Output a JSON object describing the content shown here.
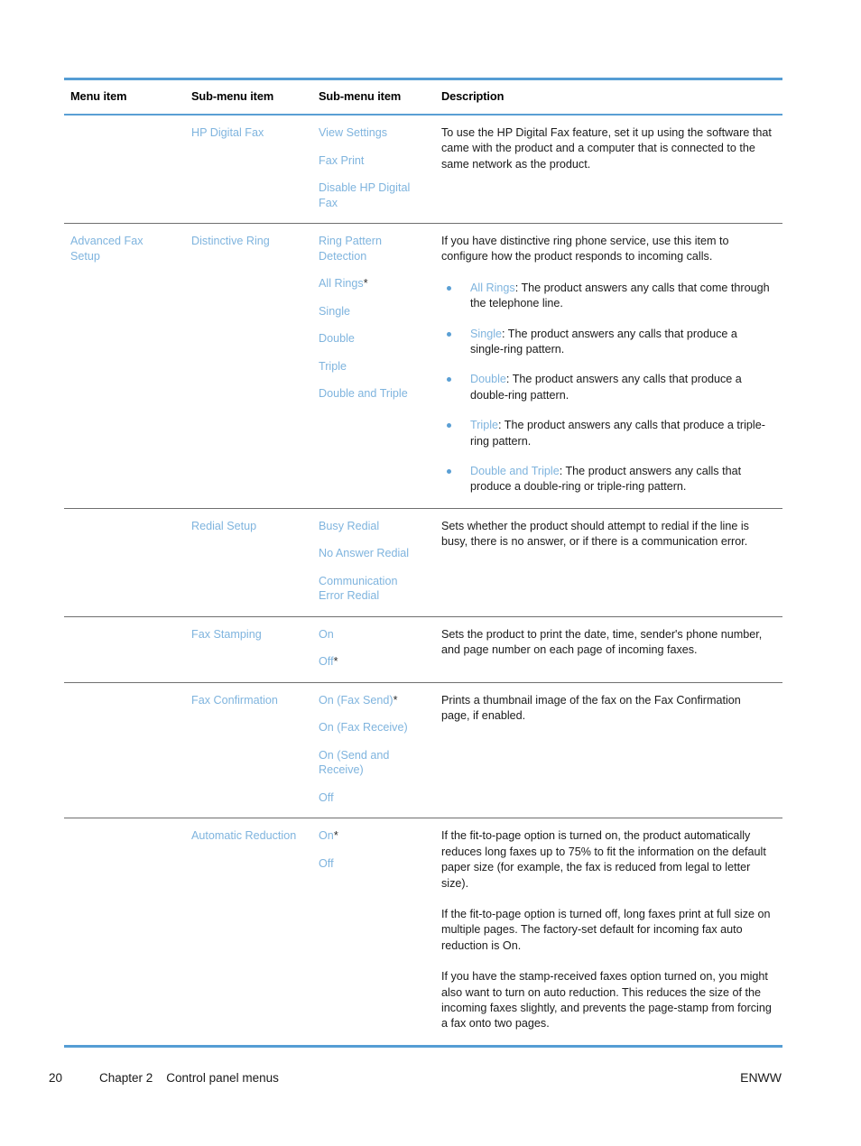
{
  "colors": {
    "accent_rule": "#559dd4",
    "link_blue": "#7fb4de",
    "body_text": "#1a1a1a",
    "row_divider": "#6f6f6f"
  },
  "table": {
    "headers": {
      "menu_item": "Menu item",
      "sub_menu_item_1": "Sub-menu item",
      "sub_menu_item_2": "Sub-menu item",
      "description": "Description"
    },
    "rows": [
      {
        "menu_item": "",
        "sub_menu_1": "HP Digital Fax",
        "sub_menu_2": [
          "View Settings",
          "Fax Print",
          "Disable HP Digital Fax"
        ],
        "description_paragraphs": [
          "To use the HP Digital Fax feature, set it up using the software that came with the product and a computer that is connected to the same network as the product."
        ],
        "bullets": []
      },
      {
        "menu_item": "Advanced Fax Setup",
        "sub_menu_1": "Distinctive Ring",
        "sub_menu_2": [
          "Ring Pattern Detection",
          "All Rings*",
          "Single",
          "Double",
          "Triple",
          "Double and Triple"
        ],
        "description_paragraphs": [
          "If you have distinctive ring phone service, use this item to configure how the product responds to incoming calls."
        ],
        "bullets": [
          {
            "term": "All Rings",
            "text": ": The product answers any calls that come through the telephone line."
          },
          {
            "term": "Single",
            "text": ": The product answers any calls that produce a single-ring pattern."
          },
          {
            "term": "Double",
            "text": ": The product answers any calls that produce a double-ring pattern."
          },
          {
            "term": "Triple",
            "text": ": The product answers any calls that produce a triple-ring pattern."
          },
          {
            "term": "Double and Triple",
            "text": ": The product answers any calls that produce a double-ring or triple-ring pattern."
          }
        ]
      },
      {
        "menu_item": "",
        "sub_menu_1": "Redial Setup",
        "sub_menu_2": [
          "Busy Redial",
          "No Answer Redial",
          "Communication Error Redial"
        ],
        "description_paragraphs": [
          "Sets whether the product should attempt to redial if the line is busy, there is no answer, or if there is a communication error."
        ],
        "bullets": []
      },
      {
        "menu_item": "",
        "sub_menu_1": "Fax Stamping",
        "sub_menu_2": [
          "On",
          "Off*"
        ],
        "description_paragraphs": [
          "Sets the product to print the date, time, sender's phone number, and page number on each page of incoming faxes."
        ],
        "bullets": []
      },
      {
        "menu_item": "",
        "sub_menu_1": "Fax Confirmation",
        "sub_menu_2": [
          "On (Fax Send)*",
          "On (Fax Receive)",
          "On (Send and Receive)",
          "Off"
        ],
        "description_paragraphs": [
          "Prints a thumbnail image of the fax on the Fax Confirmation page, if enabled."
        ],
        "bullets": []
      },
      {
        "menu_item": "",
        "sub_menu_1": "Automatic Reduction",
        "sub_menu_2": [
          "On*",
          "Off"
        ],
        "description_paragraphs": [
          "If the fit-to-page option is turned on, the product automatically reduces long faxes up to 75% to fit the information on the default paper size (for example, the fax is reduced from legal to letter size).",
          "If the fit-to-page option is turned off, long faxes print at full size on multiple pages. The factory-set default for incoming fax auto reduction is On.",
          "If you have the stamp-received faxes option turned on, you might also want to turn on auto reduction. This reduces the size of the incoming faxes slightly, and prevents the page-stamp from forcing a fax onto two pages."
        ],
        "bullets": []
      }
    ]
  },
  "footer": {
    "page_number": "20",
    "chapter": "Chapter 2",
    "section": "Control panel menus",
    "imprint": "ENWW"
  }
}
